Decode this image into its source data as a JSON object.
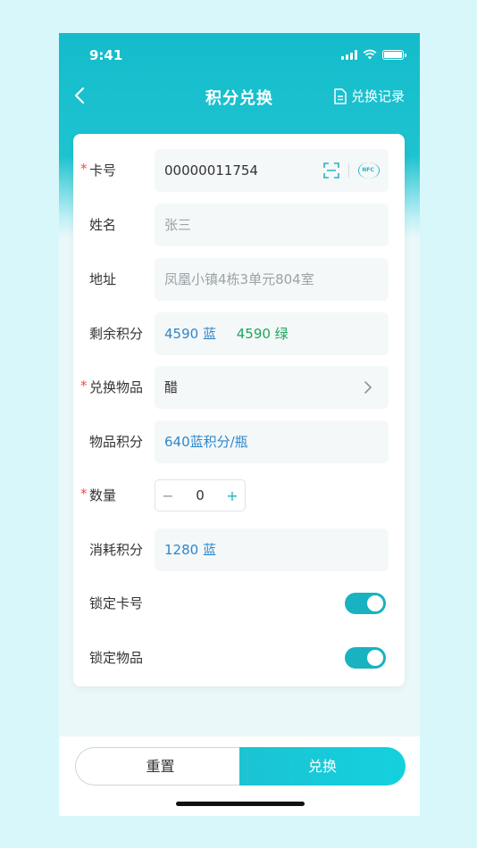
{
  "status": {
    "time": "9:41"
  },
  "nav": {
    "title": "积分兑换",
    "record_label": "兑换记录"
  },
  "form": {
    "card_number": {
      "label": "卡号",
      "value": "00000011754",
      "nfc": "NFC"
    },
    "name": {
      "label": "姓名",
      "placeholder": "张三"
    },
    "address": {
      "label": "地址",
      "placeholder": "凤凰小镇4栋3单元804室"
    },
    "remaining_points": {
      "label": "剩余积分",
      "blue": "4590 蓝",
      "green": "4590 绿"
    },
    "item": {
      "label": "兑换物品",
      "value": "醋"
    },
    "item_points": {
      "label": "物品积分",
      "value": "640蓝积分/瓶"
    },
    "quantity": {
      "label": "数量",
      "minus": "−",
      "value": "0",
      "plus": "+"
    },
    "consumed_points": {
      "label": "消耗积分",
      "value": "1280 蓝"
    },
    "lock_card": {
      "label": "锁定卡号",
      "on": true
    },
    "lock_item": {
      "label": "锁定物品",
      "on": true
    },
    "required_mark": "*"
  },
  "actions": {
    "reset_label": "重置",
    "exchange_label": "兑换"
  },
  "colors": {
    "accent": "#18b2c0",
    "blue_points": "#2f86c9",
    "green_points": "#1ea65a",
    "required": "#f04a4a"
  }
}
